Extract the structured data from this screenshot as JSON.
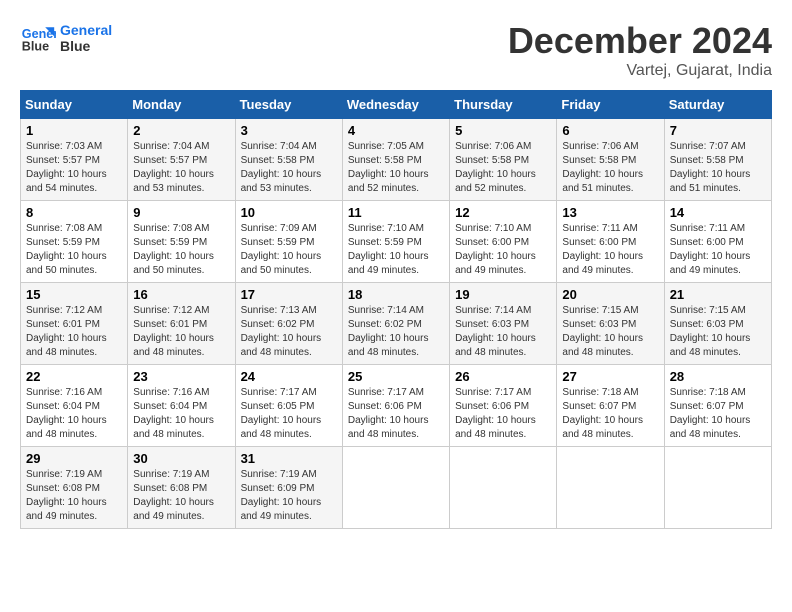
{
  "header": {
    "logo_line1": "General",
    "logo_line2": "Blue",
    "title": "December 2024",
    "subtitle": "Vartej, Gujarat, India"
  },
  "days_of_week": [
    "Sunday",
    "Monday",
    "Tuesday",
    "Wednesday",
    "Thursday",
    "Friday",
    "Saturday"
  ],
  "weeks": [
    [
      {
        "day": "1",
        "sunrise": "7:03 AM",
        "sunset": "5:57 PM",
        "daylight": "10 hours and 54 minutes."
      },
      {
        "day": "2",
        "sunrise": "7:04 AM",
        "sunset": "5:57 PM",
        "daylight": "10 hours and 53 minutes."
      },
      {
        "day": "3",
        "sunrise": "7:04 AM",
        "sunset": "5:58 PM",
        "daylight": "10 hours and 53 minutes."
      },
      {
        "day": "4",
        "sunrise": "7:05 AM",
        "sunset": "5:58 PM",
        "daylight": "10 hours and 52 minutes."
      },
      {
        "day": "5",
        "sunrise": "7:06 AM",
        "sunset": "5:58 PM",
        "daylight": "10 hours and 52 minutes."
      },
      {
        "day": "6",
        "sunrise": "7:06 AM",
        "sunset": "5:58 PM",
        "daylight": "10 hours and 51 minutes."
      },
      {
        "day": "7",
        "sunrise": "7:07 AM",
        "sunset": "5:58 PM",
        "daylight": "10 hours and 51 minutes."
      }
    ],
    [
      {
        "day": "8",
        "sunrise": "7:08 AM",
        "sunset": "5:59 PM",
        "daylight": "10 hours and 50 minutes."
      },
      {
        "day": "9",
        "sunrise": "7:08 AM",
        "sunset": "5:59 PM",
        "daylight": "10 hours and 50 minutes."
      },
      {
        "day": "10",
        "sunrise": "7:09 AM",
        "sunset": "5:59 PM",
        "daylight": "10 hours and 50 minutes."
      },
      {
        "day": "11",
        "sunrise": "7:10 AM",
        "sunset": "5:59 PM",
        "daylight": "10 hours and 49 minutes."
      },
      {
        "day": "12",
        "sunrise": "7:10 AM",
        "sunset": "6:00 PM",
        "daylight": "10 hours and 49 minutes."
      },
      {
        "day": "13",
        "sunrise": "7:11 AM",
        "sunset": "6:00 PM",
        "daylight": "10 hours and 49 minutes."
      },
      {
        "day": "14",
        "sunrise": "7:11 AM",
        "sunset": "6:00 PM",
        "daylight": "10 hours and 49 minutes."
      }
    ],
    [
      {
        "day": "15",
        "sunrise": "7:12 AM",
        "sunset": "6:01 PM",
        "daylight": "10 hours and 48 minutes."
      },
      {
        "day": "16",
        "sunrise": "7:12 AM",
        "sunset": "6:01 PM",
        "daylight": "10 hours and 48 minutes."
      },
      {
        "day": "17",
        "sunrise": "7:13 AM",
        "sunset": "6:02 PM",
        "daylight": "10 hours and 48 minutes."
      },
      {
        "day": "18",
        "sunrise": "7:14 AM",
        "sunset": "6:02 PM",
        "daylight": "10 hours and 48 minutes."
      },
      {
        "day": "19",
        "sunrise": "7:14 AM",
        "sunset": "6:03 PM",
        "daylight": "10 hours and 48 minutes."
      },
      {
        "day": "20",
        "sunrise": "7:15 AM",
        "sunset": "6:03 PM",
        "daylight": "10 hours and 48 minutes."
      },
      {
        "day": "21",
        "sunrise": "7:15 AM",
        "sunset": "6:03 PM",
        "daylight": "10 hours and 48 minutes."
      }
    ],
    [
      {
        "day": "22",
        "sunrise": "7:16 AM",
        "sunset": "6:04 PM",
        "daylight": "10 hours and 48 minutes."
      },
      {
        "day": "23",
        "sunrise": "7:16 AM",
        "sunset": "6:04 PM",
        "daylight": "10 hours and 48 minutes."
      },
      {
        "day": "24",
        "sunrise": "7:17 AM",
        "sunset": "6:05 PM",
        "daylight": "10 hours and 48 minutes."
      },
      {
        "day": "25",
        "sunrise": "7:17 AM",
        "sunset": "6:06 PM",
        "daylight": "10 hours and 48 minutes."
      },
      {
        "day": "26",
        "sunrise": "7:17 AM",
        "sunset": "6:06 PM",
        "daylight": "10 hours and 48 minutes."
      },
      {
        "day": "27",
        "sunrise": "7:18 AM",
        "sunset": "6:07 PM",
        "daylight": "10 hours and 48 minutes."
      },
      {
        "day": "28",
        "sunrise": "7:18 AM",
        "sunset": "6:07 PM",
        "daylight": "10 hours and 48 minutes."
      }
    ],
    [
      {
        "day": "29",
        "sunrise": "7:19 AM",
        "sunset": "6:08 PM",
        "daylight": "10 hours and 49 minutes."
      },
      {
        "day": "30",
        "sunrise": "7:19 AM",
        "sunset": "6:08 PM",
        "daylight": "10 hours and 49 minutes."
      },
      {
        "day": "31",
        "sunrise": "7:19 AM",
        "sunset": "6:09 PM",
        "daylight": "10 hours and 49 minutes."
      },
      null,
      null,
      null,
      null
    ]
  ],
  "labels": {
    "sunrise": "Sunrise:",
    "sunset": "Sunset:",
    "daylight": "Daylight:"
  }
}
